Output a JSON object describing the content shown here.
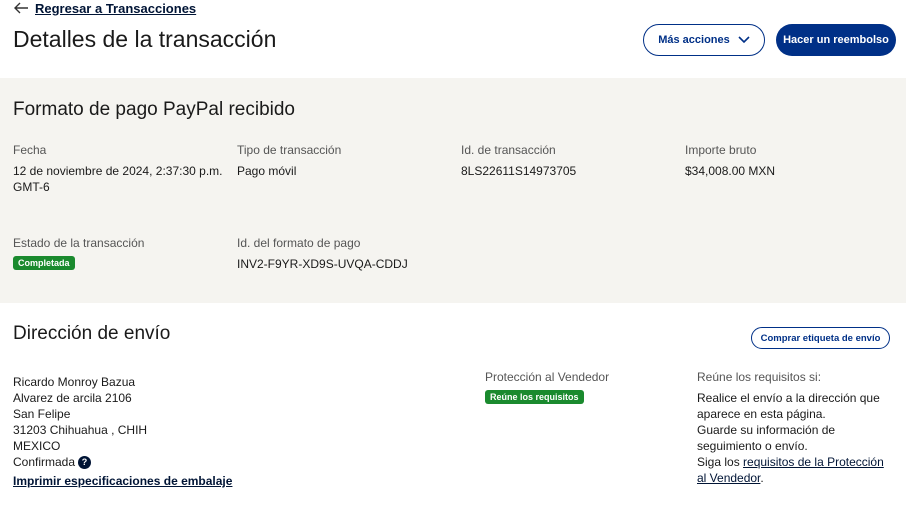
{
  "header": {
    "back_label": "Regresar a Transacciones",
    "title": "Detalles de la transacción",
    "more_actions_label": "Más acciones",
    "refund_label": "Hacer un reembolso"
  },
  "payment": {
    "title": "Formato de pago PayPal recibido",
    "date_label": "Fecha",
    "date_value_line1": "12 de noviembre de 2024, 2:37:30 p.m.",
    "date_value_line2": "GMT-6",
    "type_label": "Tipo de transacción",
    "type_value": "Pago móvil",
    "id_label": "Id. de transacción",
    "id_value": "8LS22611S14973705",
    "gross_label": "Importe bruto",
    "gross_value": "$34,008.00 MXN",
    "status_label": "Estado de la transacción",
    "status_value": "Completada",
    "form_id_label": "Id. del formato de pago",
    "form_id_value": "INV2-F9YR-XD9S-UVQA-CDDJ"
  },
  "shipping": {
    "title": "Dirección de envío",
    "buy_label_button": "Comprar etiqueta de envío",
    "address_lines": [
      "Ricardo Monroy Bazua",
      "Alvarez de arcila 2106",
      "San Felipe",
      "31203 Chihuahua , CHIH",
      "MEXICO"
    ],
    "confirmed": "Confirmada",
    "print_link": "Imprimir especificaciones de embalaje",
    "protection_label": "Protección al Vendedor",
    "protection_badge": "Reúne los requisitos",
    "req_title": "Reúne los requisitos si:",
    "req_lines": [
      "Realice el envío a la dirección que",
      "aparece en esta página.",
      "Guarde su información de",
      "seguimiento o envío."
    ],
    "req_follow_prefix": "Siga los ",
    "req_follow_link_1": "requisitos de la Protección",
    "req_follow_link_2": "al Vendedor",
    "req_follow_suffix": "."
  },
  "colors": {
    "primary": "#003087",
    "success": "#1a8a2e",
    "panel_bg": "#f5f4f0"
  }
}
